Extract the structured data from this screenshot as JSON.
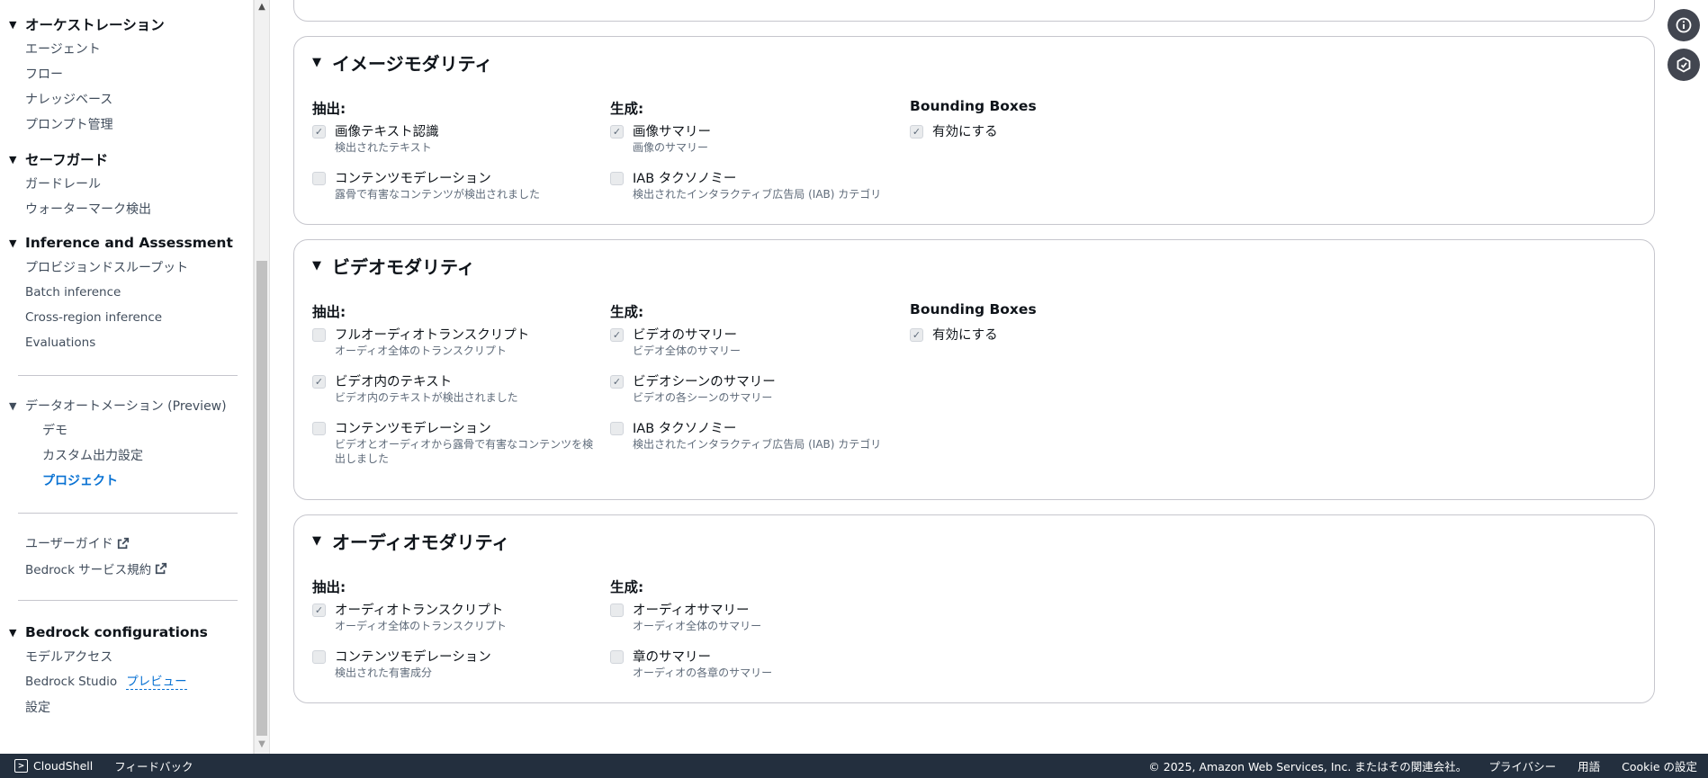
{
  "sidebar": {
    "orchestration": {
      "title": "オーケストレーション",
      "items": [
        "エージェント",
        "フロー",
        "ナレッジベース",
        "プロンプト管理"
      ]
    },
    "safeguard": {
      "title": "セーフガード",
      "items": [
        "ガードレール",
        "ウォーターマーク検出"
      ]
    },
    "inference": {
      "title": "Inference and Assessment",
      "items": [
        "プロビジョンドスループット",
        "Batch inference",
        "Cross-region inference",
        "Evaluations"
      ]
    },
    "data_automation": {
      "title": "データオートメーション (Preview)",
      "items": [
        "デモ",
        "カスタム出力設定",
        "プロジェクト"
      ]
    },
    "links": {
      "user_guide": "ユーザーガイド",
      "terms": "Bedrock サービス規約"
    },
    "configurations": {
      "title": "Bedrock configurations",
      "model_access": "モデルアクセス",
      "studio": "Bedrock Studio",
      "studio_badge": "プレビュー",
      "settings": "設定"
    }
  },
  "image_modality": {
    "title": "イメージモダリティ",
    "extract_title": "抽出:",
    "generate_title": "生成:",
    "bbox_title": "Bounding Boxes",
    "extract": [
      {
        "label": "画像テキスト認識",
        "desc": "検出されたテキスト",
        "checked": true
      },
      {
        "label": "コンテンツモデレーション",
        "desc": "露骨で有害なコンテンツが検出されました",
        "checked": false
      }
    ],
    "generate": [
      {
        "label": "画像サマリー",
        "desc": "画像のサマリー",
        "checked": true
      },
      {
        "label": "IAB タクソノミー",
        "desc": "検出されたインタラクティブ広告局 (IAB) カテゴリ",
        "checked": false
      }
    ],
    "bbox": {
      "label": "有効にする",
      "checked": true
    }
  },
  "video_modality": {
    "title": "ビデオモダリティ",
    "extract_title": "抽出:",
    "generate_title": "生成:",
    "bbox_title": "Bounding Boxes",
    "extract": [
      {
        "label": "フルオーディオトランスクリプト",
        "desc": "オーディオ全体のトランスクリプト",
        "checked": false
      },
      {
        "label": "ビデオ内のテキスト",
        "desc": "ビデオ内のテキストが検出されました",
        "checked": true
      },
      {
        "label": "コンテンツモデレーション",
        "desc": "ビデオとオーディオから露骨で有害なコンテンツを検出しました",
        "checked": false
      }
    ],
    "generate": [
      {
        "label": "ビデオのサマリー",
        "desc": "ビデオ全体のサマリー",
        "checked": true
      },
      {
        "label": "ビデオシーンのサマリー",
        "desc": "ビデオの各シーンのサマリー",
        "checked": true
      },
      {
        "label": "IAB タクソノミー",
        "desc": "検出されたインタラクティブ広告局 (IAB) カテゴリ",
        "checked": false
      }
    ],
    "bbox": {
      "label": "有効にする",
      "checked": true
    }
  },
  "audio_modality": {
    "title": "オーディオモダリティ",
    "extract_title": "抽出:",
    "generate_title": "生成:",
    "extract": [
      {
        "label": "オーディオトランスクリプト",
        "desc": "オーディオ全体のトランスクリプト",
        "checked": true
      },
      {
        "label": "コンテンツモデレーション",
        "desc": "検出された有害成分",
        "checked": false
      }
    ],
    "generate": [
      {
        "label": "オーディオサマリー",
        "desc": "オーディオ全体のサマリー",
        "checked": false
      },
      {
        "label": "章のサマリー",
        "desc": "オーディオの各章のサマリー",
        "checked": false
      }
    ]
  },
  "footer": {
    "cloudshell": "CloudShell",
    "feedback": "フィードバック",
    "copyright": "© 2025, Amazon Web Services, Inc. またはその関連会社。",
    "privacy": "プライバシー",
    "terms": "用語",
    "cookie": "Cookie の設定"
  },
  "icons": {
    "info": "info-icon",
    "ai": "ai-assistant-icon",
    "check": "✓"
  }
}
